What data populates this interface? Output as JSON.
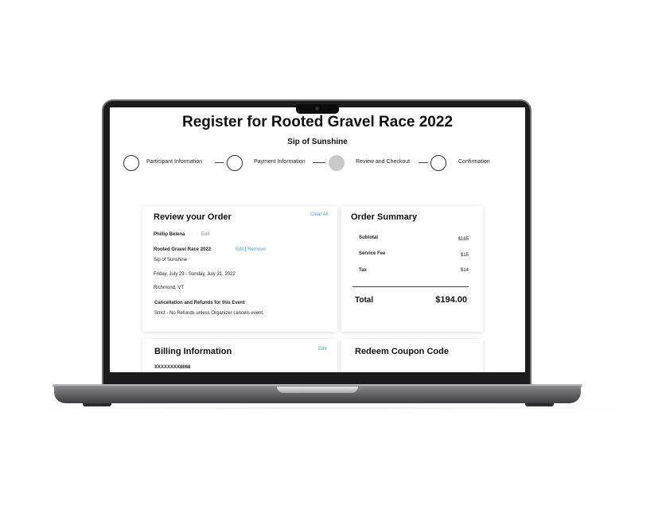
{
  "page": {
    "title": "Register for Rooted Gravel Race 2022",
    "subtitle": "Sip of Sunshine"
  },
  "steps": [
    {
      "label": "Participant  Information",
      "state": "incomplete"
    },
    {
      "label": "Payment Information",
      "state": "incomplete"
    },
    {
      "label": "Review and Checkout",
      "state": "current"
    },
    {
      "label": "Confirmation",
      "state": "incomplete"
    }
  ],
  "review": {
    "title": "Review your Order",
    "clear_all": "Clear All",
    "participant_name": "Phillip Belena",
    "participant_edit": "Edit",
    "event_name": "Rooted Gravel Race 2022",
    "event_edit": "Edit",
    "event_separator": "|",
    "event_remove": "Remove",
    "event_subtitle": "Sip of Sunshine",
    "dates": "Friday, July 29 - Sunday, July 31, 2022",
    "location": "Richmond, VT",
    "policy_heading": "Cancellation and Refunds for this Event",
    "policy_text": "Strict - No Refunds unless Organizer cancels event."
  },
  "summary": {
    "title": "Order Summary",
    "rows": [
      {
        "label": "Subtotal",
        "value": "$165"
      },
      {
        "label": "Service Fee",
        "value": "$15"
      },
      {
        "label": "Tax",
        "value": "$14"
      }
    ],
    "total_label": "Total",
    "total_value": "$194.00"
  },
  "billing": {
    "title": "Billing Information",
    "edit": "Edit",
    "card_masked": "XXXXXXXX8668"
  },
  "coupon": {
    "title": "Redeem Coupon Code"
  },
  "colors": {
    "link": "#4a9de0",
    "active_step": "#c9c9c9",
    "laptop_body": "#6d6d72"
  }
}
